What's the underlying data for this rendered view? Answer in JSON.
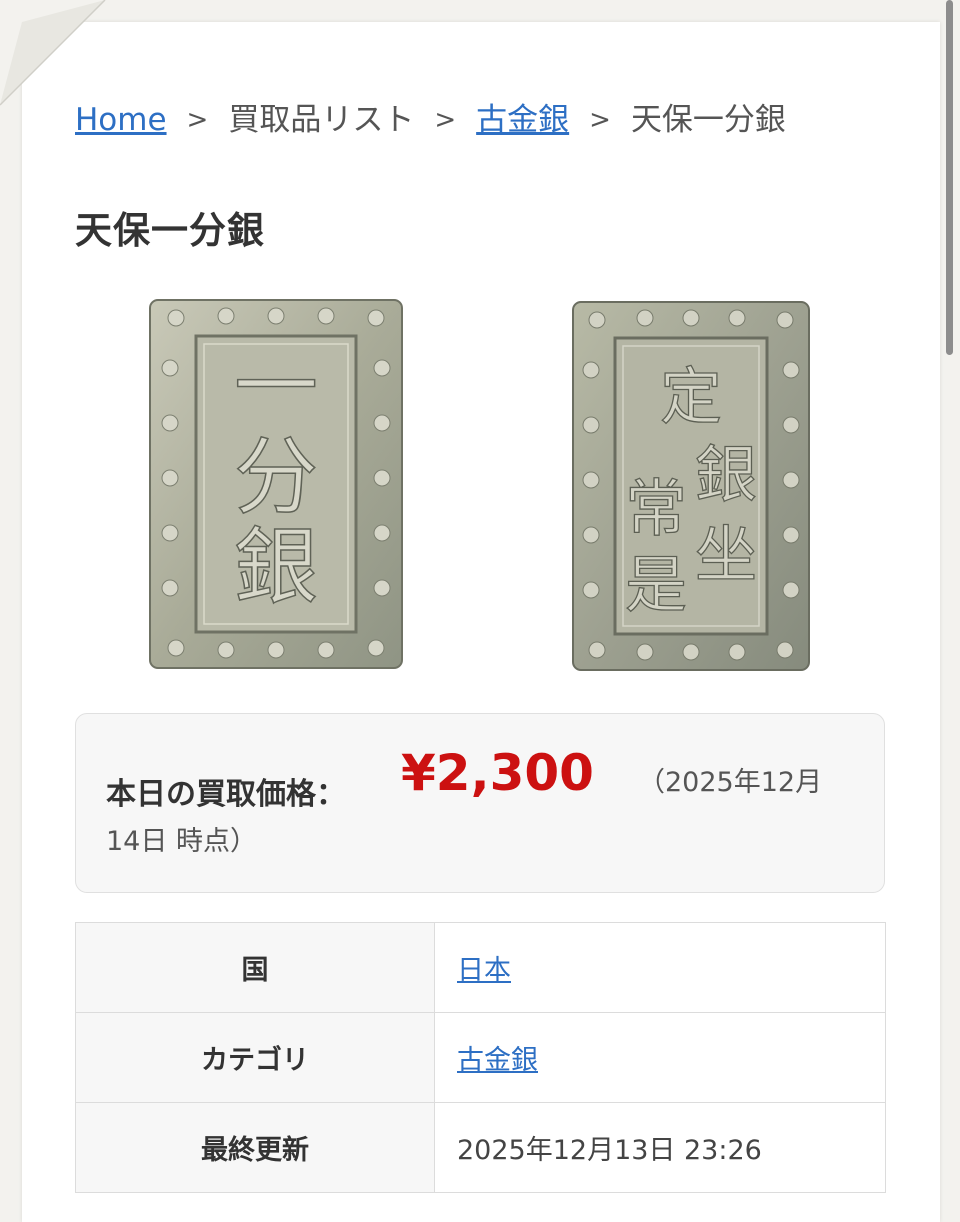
{
  "breadcrumb": {
    "home": "Home",
    "sep1": ">",
    "list": "買取品リスト",
    "sep2": ">",
    "category": "古金銀",
    "sep3": ">",
    "current": "天保一分銀"
  },
  "page_title": "天保一分銀",
  "images": {
    "front_text": [
      "一",
      "分",
      "銀"
    ],
    "back_text": [
      "定",
      "銀",
      "常",
      "坐",
      "是"
    ]
  },
  "price": {
    "label": "本日の買取価格：",
    "value": "¥2,300",
    "as_of_line1": "（2025年12月",
    "as_of_line2": "14日 時点）"
  },
  "details": {
    "country_label": "国",
    "country_value": "日本",
    "category_label": "カテゴリ",
    "category_value": "古金銀",
    "updated_label": "最終更新",
    "updated_value": "2025年12月13日 23:26"
  },
  "colors": {
    "link": "#2d6fc4",
    "price": "#cc1111",
    "coin_silver": "#b8b9a6"
  }
}
